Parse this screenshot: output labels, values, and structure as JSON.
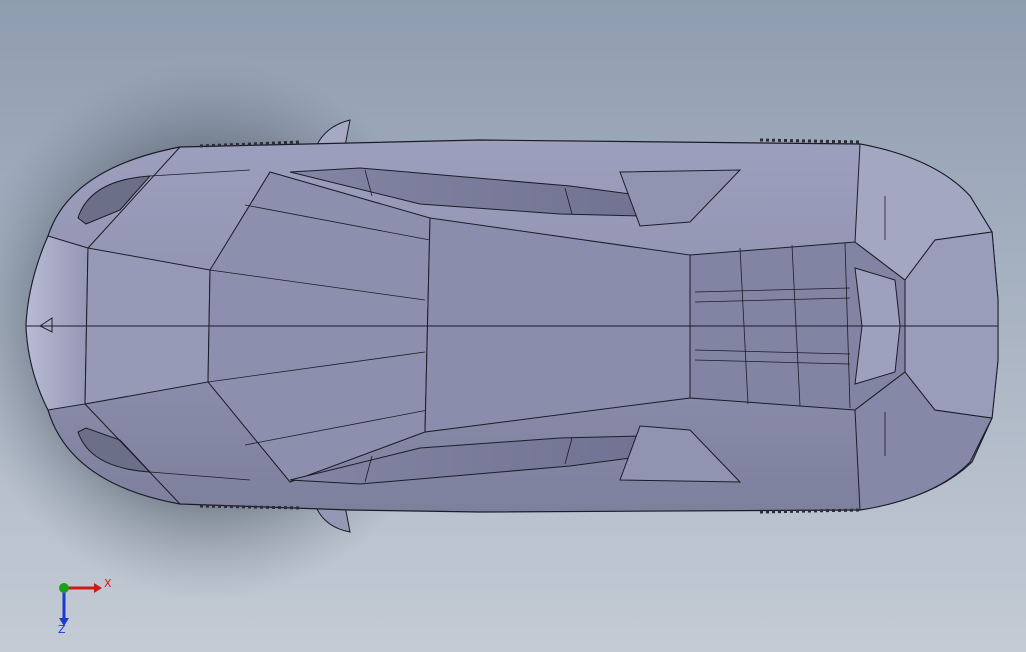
{
  "viewport": {
    "background_top": "#8f9db0",
    "background_bottom": "#c4cbd5",
    "model_face_color": "#9396b3",
    "model_edge_color": "#1c1c28"
  },
  "triad": {
    "x_label": "X",
    "z_label": "Z",
    "x_color": "#d01818",
    "y_color": "#1ca01c",
    "z_color": "#1c3ad0"
  }
}
